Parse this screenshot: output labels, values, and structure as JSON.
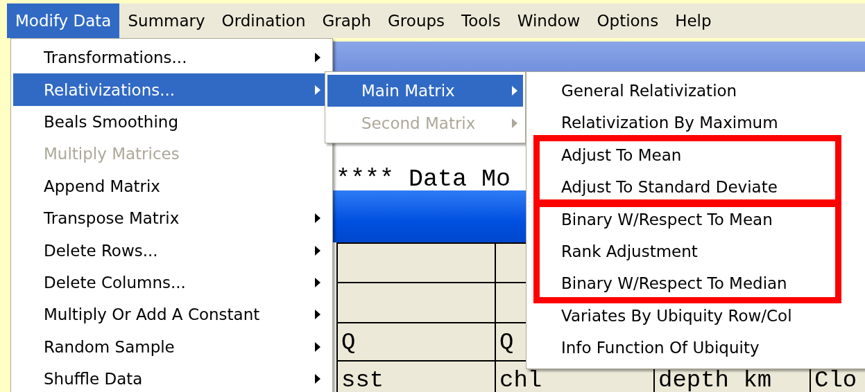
{
  "menubar": [
    {
      "label": "Modify Data",
      "selected": true
    },
    {
      "label": "Summary",
      "selected": false
    },
    {
      "label": "Ordination",
      "selected": false
    },
    {
      "label": "Graph",
      "selected": false
    },
    {
      "label": "Groups",
      "selected": false
    },
    {
      "label": "Tools",
      "selected": false
    },
    {
      "label": "Window",
      "selected": false
    },
    {
      "label": "Options",
      "selected": false
    },
    {
      "label": "Help",
      "selected": false
    }
  ],
  "document_window": {
    "text": "**** Data Mo",
    "grid_rows": [
      [
        "Q",
        "Q"
      ],
      [
        "sst",
        "chl",
        "depth km",
        "Clo"
      ]
    ]
  },
  "modify_data_menu": [
    {
      "label": "Transformations...",
      "selected": false,
      "disabled": false,
      "submenu": true
    },
    {
      "label": "Relativizations...",
      "selected": true,
      "disabled": false,
      "submenu": true
    },
    {
      "label": "Beals Smoothing",
      "selected": false,
      "disabled": false,
      "submenu": false
    },
    {
      "label": "Multiply Matrices",
      "selected": false,
      "disabled": true,
      "submenu": false
    },
    {
      "label": "Append Matrix",
      "selected": false,
      "disabled": false,
      "submenu": false
    },
    {
      "label": "Transpose Matrix",
      "selected": false,
      "disabled": false,
      "submenu": true
    },
    {
      "label": "Delete Rows...",
      "selected": false,
      "disabled": false,
      "submenu": true
    },
    {
      "label": "Delete Columns...",
      "selected": false,
      "disabled": false,
      "submenu": true
    },
    {
      "label": "Multiply Or Add A Constant",
      "selected": false,
      "disabled": false,
      "submenu": true
    },
    {
      "label": "Random Sample",
      "selected": false,
      "disabled": false,
      "submenu": true
    },
    {
      "label": "Shuffle Data",
      "selected": false,
      "disabled": false,
      "submenu": true
    }
  ],
  "relativizations_menu": [
    {
      "label": "Main Matrix",
      "selected": true,
      "disabled": false,
      "submenu": true
    },
    {
      "label": "Second Matrix",
      "selected": false,
      "disabled": true,
      "submenu": true
    }
  ],
  "main_matrix_menu": {
    "sections": [
      {
        "kind": "plain",
        "items": [
          "General Relativization",
          "Relativization By Maximum"
        ]
      },
      {
        "kind": "framed",
        "items": [
          "Adjust To Mean",
          "Adjust To Standard Deviate"
        ]
      },
      {
        "kind": "framed",
        "items": [
          "Binary W/Respect To Mean",
          "Rank Adjustment",
          "Binary W/Respect To Median"
        ]
      },
      {
        "kind": "plain",
        "items": [
          "Variates By Ubiquity Row/Col",
          "Info Function Of Ubiquity"
        ]
      }
    ]
  }
}
